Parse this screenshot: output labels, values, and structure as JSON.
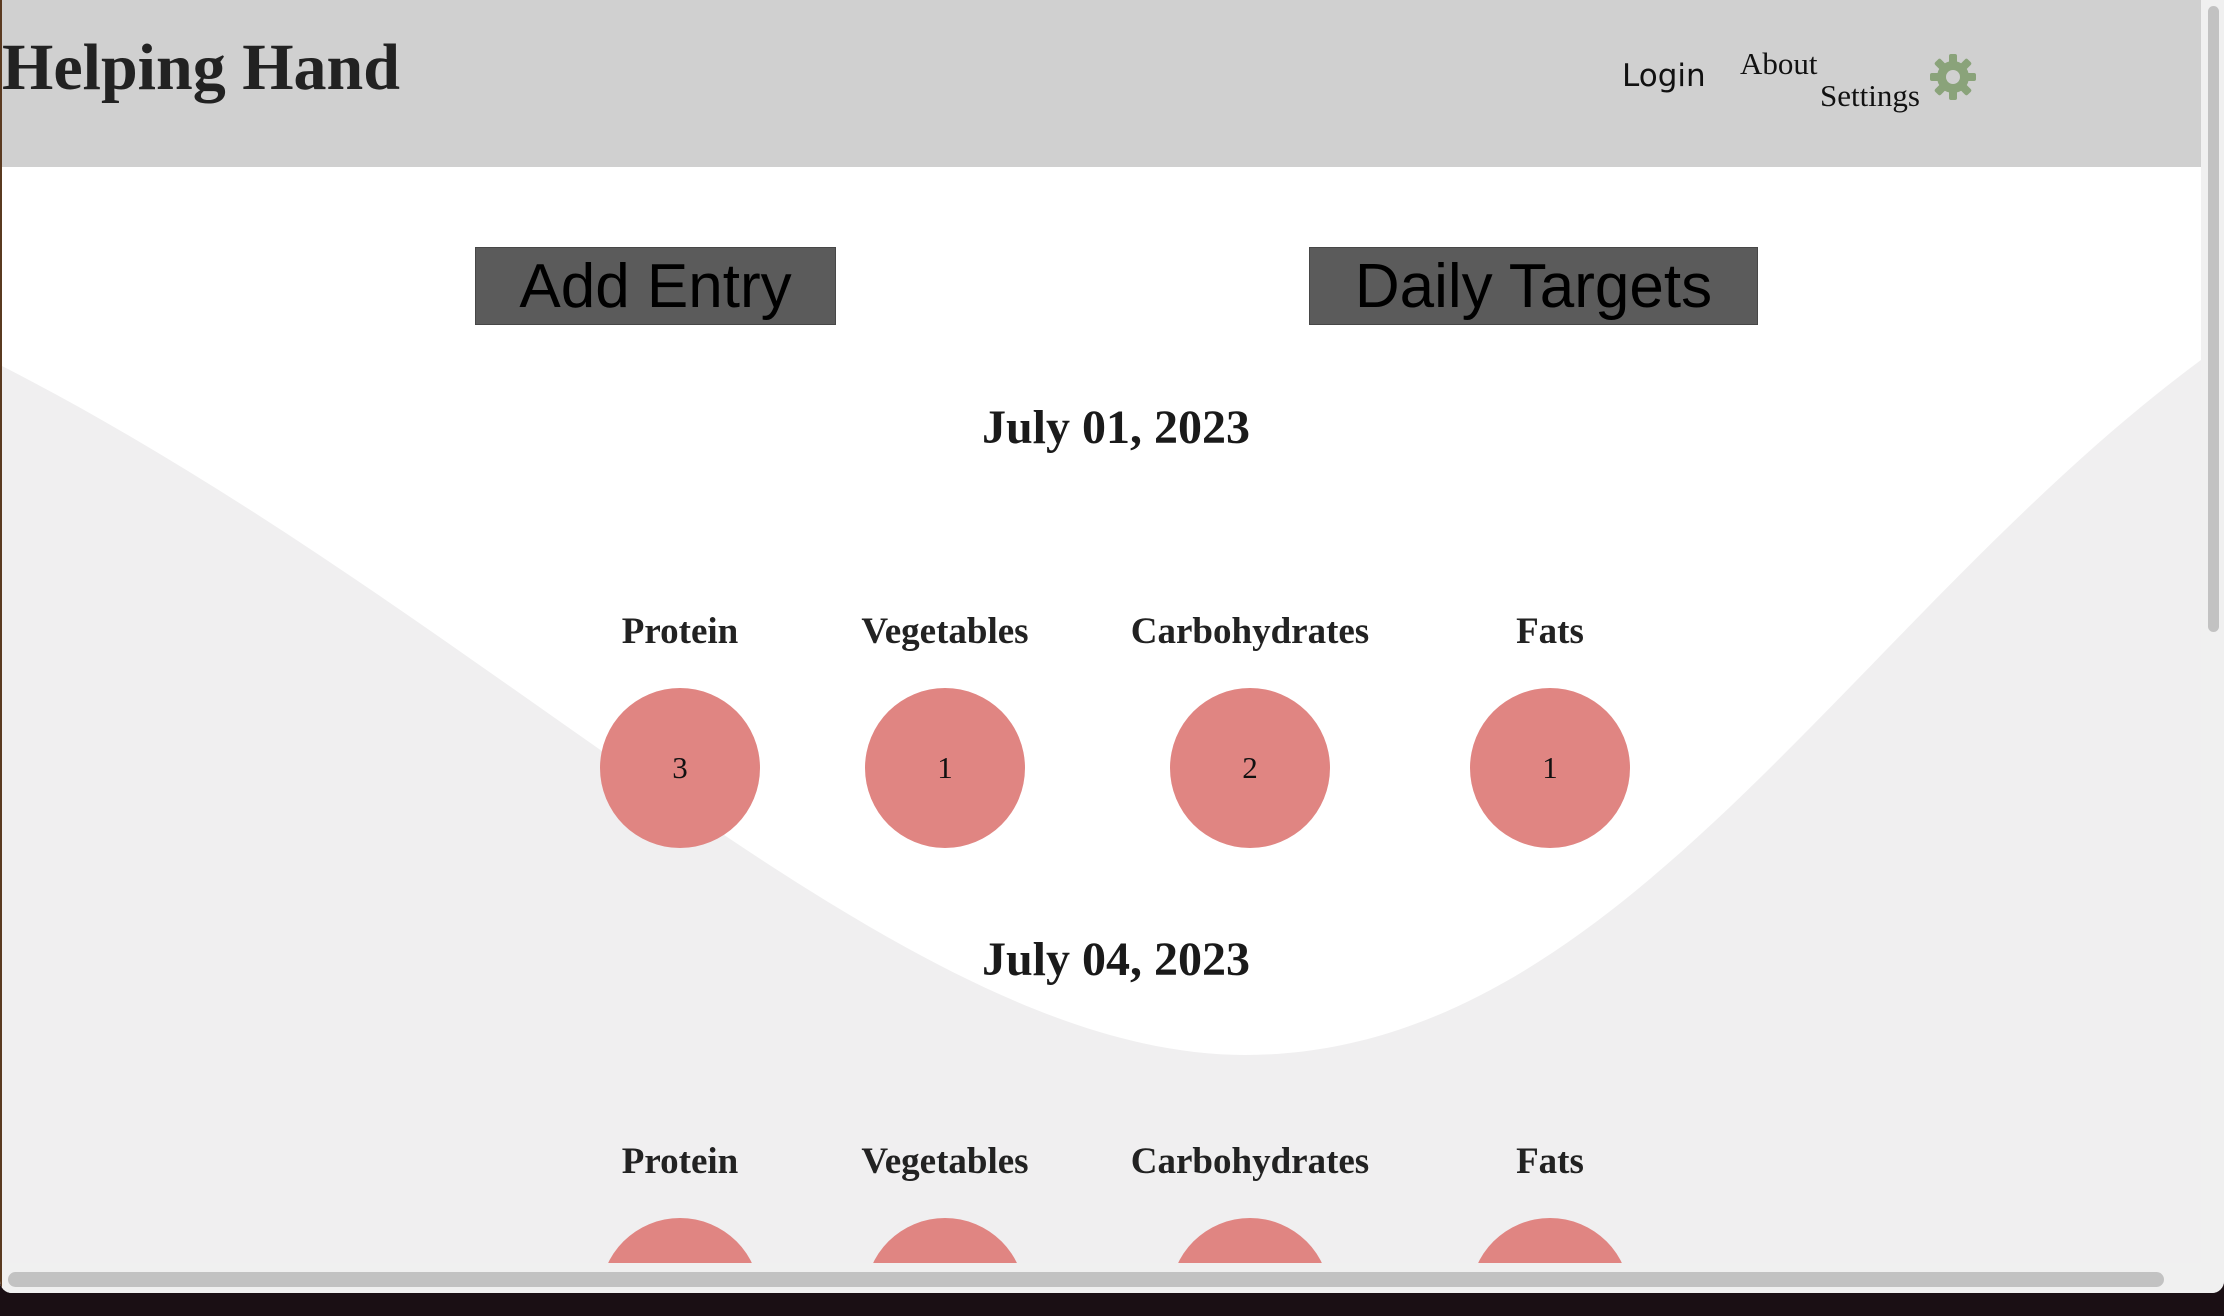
{
  "app": {
    "title": "Helping Hand"
  },
  "nav": {
    "login": "Login",
    "about": "About",
    "settings": "Settings",
    "settings_icon": "gear-icon"
  },
  "actions": {
    "add_entry": "Add Entry",
    "daily_targets": "Daily Targets"
  },
  "colors": {
    "header_bg": "#d0d0d0",
    "button_bg": "#5b5b5b",
    "circle_fill": "#e08582",
    "gear": "#8aa37a",
    "wave": "#f0eff0"
  },
  "days": [
    {
      "date": "July 01, 2023",
      "groups": [
        {
          "label": "Protein",
          "value": "3"
        },
        {
          "label": "Vegetables",
          "value": "1"
        },
        {
          "label": "Carbohydrates",
          "value": "2"
        },
        {
          "label": "Fats",
          "value": "1"
        }
      ]
    },
    {
      "date": "July 04, 2023",
      "groups": [
        {
          "label": "Protein",
          "value": ""
        },
        {
          "label": "Vegetables",
          "value": ""
        },
        {
          "label": "Carbohydrates",
          "value": ""
        },
        {
          "label": "Fats",
          "value": ""
        }
      ]
    }
  ]
}
